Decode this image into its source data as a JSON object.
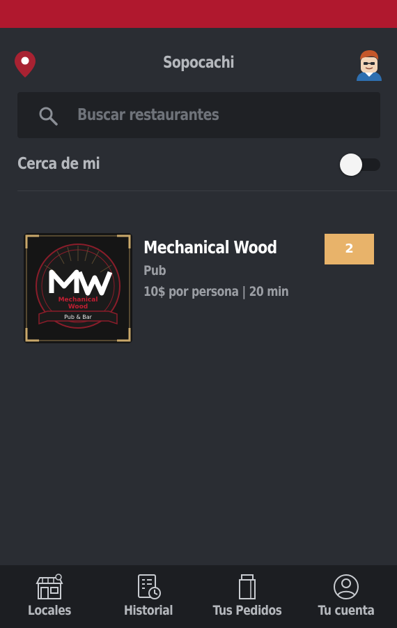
{
  "header": {
    "location": "Sopocachi"
  },
  "search": {
    "placeholder": "Buscar restaurantes",
    "value": ""
  },
  "filters": {
    "near_me_label": "Cerca de mi",
    "near_me_enabled": false
  },
  "restaurants": [
    {
      "name": "Mechanical Wood",
      "type": "Pub",
      "info": "10$ por persona | 20 min",
      "badge": "2",
      "logo_text_top": "Mechanical",
      "logo_text_bottom": "Wood",
      "logo_text_ribbon": "Pub & Bar"
    }
  ],
  "nav": {
    "items": [
      {
        "label": "Locales",
        "icon": "store-icon"
      },
      {
        "label": "Historial",
        "icon": "history-icon"
      },
      {
        "label": "Tus Pedidos",
        "icon": "bag-icon"
      },
      {
        "label": "Tu cuenta",
        "icon": "account-icon"
      }
    ]
  },
  "colors": {
    "status_bar": "#b0182e",
    "background": "#2a2d33",
    "badge": "#e8b36a",
    "pin": "#a82232"
  }
}
